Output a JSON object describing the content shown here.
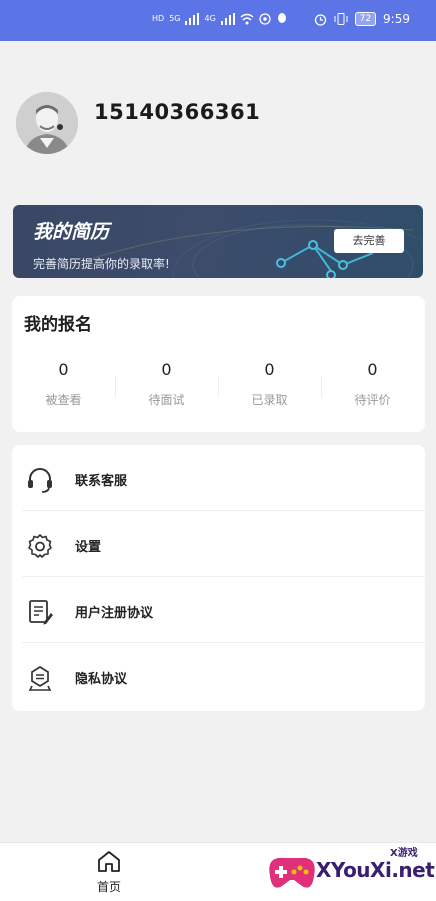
{
  "status_bar": {
    "time": "9:59",
    "battery": "72",
    "network_left": "HD",
    "network_gen": "5G",
    "network_gen2": "4G"
  },
  "profile": {
    "phone": "15140366361"
  },
  "resume_banner": {
    "title": "我的简历",
    "subtitle": "完善简历提高你的录取率!",
    "button_label": "去完善"
  },
  "signup": {
    "title": "我的报名",
    "stats": [
      {
        "value": "0",
        "label": "被查看"
      },
      {
        "value": "0",
        "label": "待面试"
      },
      {
        "value": "0",
        "label": "已录取"
      },
      {
        "value": "0",
        "label": "待评价"
      }
    ]
  },
  "menu": {
    "items": [
      {
        "label": "联系客服",
        "icon": "headset-icon"
      },
      {
        "label": "设置",
        "icon": "gear-icon"
      },
      {
        "label": "用户注册协议",
        "icon": "document-edit-icon"
      },
      {
        "label": "隐私协议",
        "icon": "privacy-badge-icon"
      }
    ]
  },
  "tabbar": {
    "home_label": "首页"
  },
  "watermark": {
    "brand": "XYouXi.net",
    "tag": "X游戏"
  },
  "colors": {
    "status_bar": "#5b74e6",
    "banner": "#3a4766",
    "background": "#f1f1f1"
  }
}
